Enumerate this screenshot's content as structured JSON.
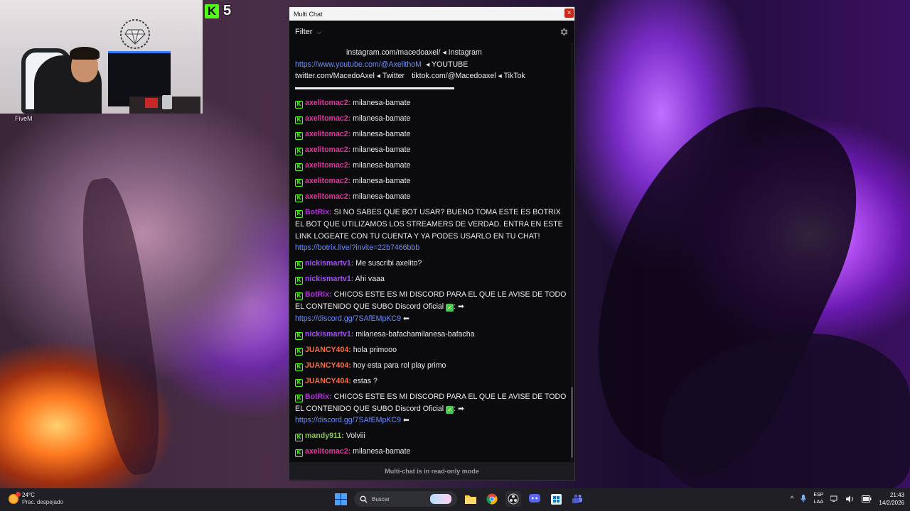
{
  "overlay": {
    "camera_label": "FiveM",
    "kick_viewers": "5"
  },
  "window": {
    "title": "Multi Chat",
    "close_glyph": "×",
    "filter_label": "Filter",
    "filter_chevron": "⌵",
    "readonly_notice": "Multi-chat is in read-only mode"
  },
  "socials": {
    "instagram": "instagram.com/macedoaxel/ ◂ Instagram",
    "youtube_link": "https://www.youtube.com/@AxelithoM",
    "youtube_label": "◂ YOUTUBE",
    "twitter": "twitter.com/MacedoAxel ◂ Twitter",
    "tiktok": "tiktok.com/@Macedoaxel ◂ TikTok"
  },
  "messages": [
    {
      "user": "axelitomac2:",
      "text": "milanesa-bamate"
    },
    {
      "user": "axelitomac2:",
      "text": "milanesa-bamate"
    },
    {
      "user": "axelitomac2:",
      "text": "milanesa-bamate"
    },
    {
      "user": "axelitomac2:",
      "text": "milanesa-bamate"
    },
    {
      "user": "axelitomac2:",
      "text": "milanesa-bamate"
    },
    {
      "user": "axelitomac2:",
      "text": "milanesa-bamate"
    },
    {
      "user": "axelitomac2:",
      "text": "milanesa-bamate"
    },
    {
      "user": "BotRix:",
      "text": "SI NO SABES QUE BOT USAR? BUENO TOMA ESTE ES BOTRIX EL BOT QUE UTILIZAMOS LOS STREAMERS DE VERDAD. ENTRA EN ESTE LINK LOGEATE CON TU CUENTA Y YA PODES USARLO EN TU CHAT!",
      "link": "https://botrix.live/?invite=22b7466bbb"
    },
    {
      "user": "nickismartv1:",
      "text": "Me suscribi axelito?"
    },
    {
      "user": "nickismartv1:",
      "text": "Ahi vaaa"
    },
    {
      "user": "BotRix:",
      "text": "CHICOS ESTE ES MI DISCORD PARA EL QUE LE AVISE DE TODO EL CONTENIDO QUE SUBO Discord Oficial",
      "after_check": ": ➡",
      "link": "https://discord.gg/7SAfEMpKC9",
      "link_suffix": "⬅"
    },
    {
      "user": "nickismartv1:",
      "text": "milanesa-bafachamilanesa-bafacha"
    },
    {
      "user": "JUANCY404:",
      "text": "hola primooo"
    },
    {
      "user": "JUANCY404:",
      "text": "hoy esta para rol play primo"
    },
    {
      "user": "JUANCY404:",
      "text": "estas ?"
    },
    {
      "user": "BotRix:",
      "text": "CHICOS ESTE ES MI DISCORD PARA EL QUE LE AVISE DE TODO EL CONTENIDO QUE SUBO Discord Oficial",
      "after_check": ": ➡",
      "link": "https://discord.gg/7SAfEMpKC9",
      "link_suffix": "⬅"
    },
    {
      "user": "mandy911:",
      "text": "Volviii"
    },
    {
      "user": "axelitomac2:",
      "text": "milanesa-bamate"
    }
  ],
  "colors": {
    "kick_green": "#53fc18",
    "axelitomac2": "#e1369e",
    "botrix": "#b829e0",
    "nickismartv1": "#a64dff",
    "juancy404": "#ff6a3d",
    "mandy911": "#8cc63f",
    "link": "#6d8eff"
  },
  "taskbar": {
    "temperature": "24°C",
    "weather_desc": "Prac. despejado",
    "search_placeholder": "Buscar",
    "lang_top": "ESP",
    "lang_bottom": "LAA",
    "time": "21:43",
    "date": "14/2/2026"
  }
}
